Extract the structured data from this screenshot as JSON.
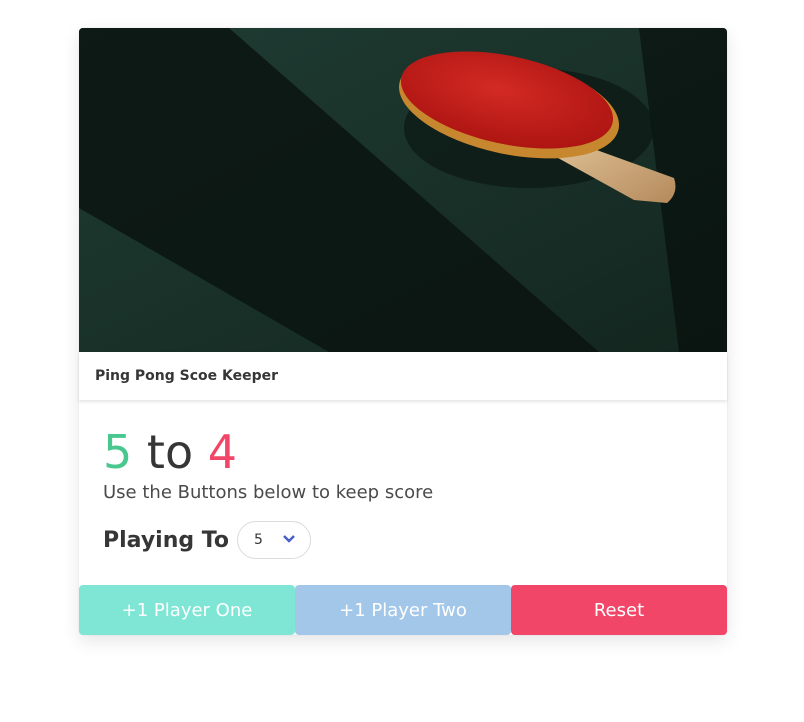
{
  "card": {
    "image_alt": "Ping pong paddle on table",
    "caption": "Ping Pong Scoe Keeper",
    "score": {
      "player_one": "5",
      "separator": "to",
      "player_two": "4"
    },
    "subtitle": "Use the Buttons below to keep score",
    "playing_to": {
      "label": "Playing To",
      "selected": "5"
    },
    "buttons": {
      "player_one": "+1 Player One",
      "player_two": "+1 Player Two",
      "reset": "Reset"
    }
  },
  "colors": {
    "player_one": "#48c78e",
    "player_two": "#f14668",
    "button_one": "#7fe6d5",
    "button_two": "#a3c7e8",
    "button_reset": "#f14668"
  },
  "icons": {
    "select_arrow": "chevron-down-icon"
  }
}
